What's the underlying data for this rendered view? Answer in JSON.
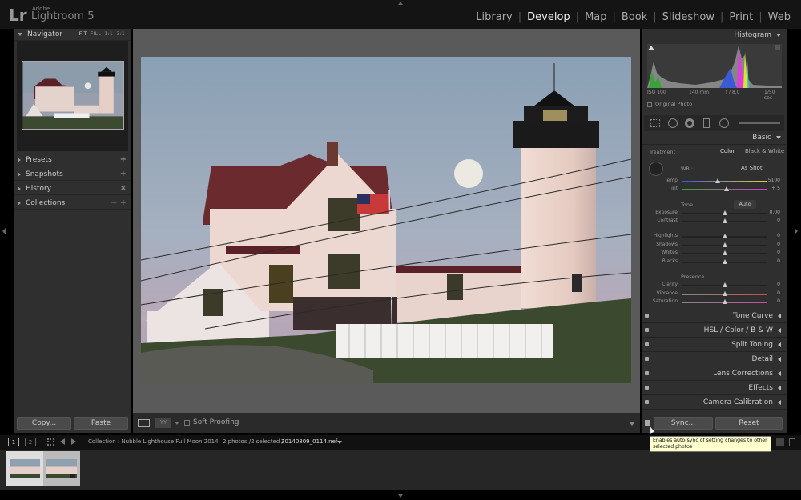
{
  "app": {
    "logo": "Lr",
    "brand_small": "Adobe",
    "brand_big": "Lightroom 5"
  },
  "modules": [
    "Library",
    "Develop",
    "Map",
    "Book",
    "Slideshow",
    "Print",
    "Web"
  ],
  "active_module": "Develop",
  "left_panel": {
    "navigator": {
      "title": "Navigator",
      "options": [
        "FIT",
        "FILL",
        "1:1",
        "3:1"
      ]
    },
    "sections": [
      {
        "label": "Presets",
        "action": "+"
      },
      {
        "label": "Snapshots",
        "action": "+"
      },
      {
        "label": "History",
        "action": "×"
      },
      {
        "label": "Collections",
        "action": "− +"
      }
    ],
    "copy_button": "Copy...",
    "paste_button": "Paste"
  },
  "toolbar": {
    "soft_proofing": "Soft Proofing"
  },
  "right_panel": {
    "histogram": {
      "title": "Histogram",
      "iso": "ISO 100",
      "focal": "140 mm",
      "aperture": "f / 8.0",
      "shutter": "1/50 sec",
      "original_photo": "Original Photo"
    },
    "basic": {
      "title": "Basic",
      "treatment_label": "Treatment :",
      "color": "Color",
      "bw": "Black & White",
      "wb_label": "WB :",
      "wb_value": "As Shot",
      "tone_label": "Tone",
      "auto_label": "Auto",
      "presence_label": "Presence",
      "sliders_wb": [
        {
          "name": "Temp",
          "value": "5100",
          "pos": 0.42
        },
        {
          "name": "Tint",
          "value": "+ 5",
          "pos": 0.52
        }
      ],
      "sliders_tone": [
        {
          "name": "Exposure",
          "value": "0.00",
          "pos": 0.5
        },
        {
          "name": "Contrast",
          "value": "0",
          "pos": 0.5
        },
        {
          "name": "Highlights",
          "value": "0",
          "pos": 0.5
        },
        {
          "name": "Shadows",
          "value": "0",
          "pos": 0.5
        },
        {
          "name": "Whites",
          "value": "0",
          "pos": 0.5
        },
        {
          "name": "Blacks",
          "value": "0",
          "pos": 0.5
        }
      ],
      "sliders_presence": [
        {
          "name": "Clarity",
          "value": "0",
          "pos": 0.5
        },
        {
          "name": "Vibrance",
          "value": "0",
          "pos": 0.5
        },
        {
          "name": "Saturation",
          "value": "0",
          "pos": 0.5
        }
      ]
    },
    "sections": [
      "Tone Curve",
      "HSL  /  Color  /  B & W",
      "Split Toning",
      "Detail",
      "Lens Corrections",
      "Effects",
      "Camera Calibration"
    ],
    "sync_button": "Sync...",
    "reset_button": "Reset"
  },
  "filmbar": {
    "page1": "1",
    "page2": "2",
    "collection": "Collection : Nubble Lighthouse Full Moon 2014",
    "count": "2 photos /2 selected /",
    "filename": "20140809_0114.nef"
  },
  "tooltip": "Enables auto-sync of setting changes to other selected photos"
}
